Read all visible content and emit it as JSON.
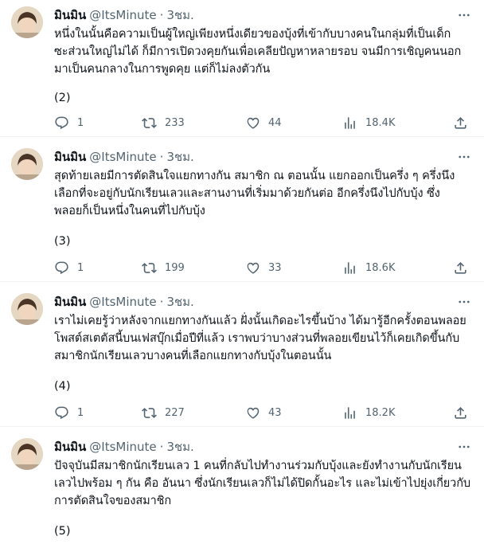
{
  "tweets": [
    {
      "name": "มินมิน",
      "handle": "@ItsMinute",
      "dot": "·",
      "time": "3ชม.",
      "text": "หนึ่งในนั้นคือความเป็นผู้ใหญ่เพียงหนึ่งเดียวของบุ้งที่เข้ากับบางคนในกลุ่มที่เป็นเด็ก\nซะส่วนใหญ่ไม่ได้ ก็มีการเปิดวงคุยกันเพื่อเคลียปัญหาหลายรอบ จนมีการเชิญคนนอก\nมาเป็นคนกลางในการพูดคุย แต่ก็ไม่ลงตัวกัน",
      "index": "(2)",
      "replies": "1",
      "retweets": "233",
      "likes": "44",
      "views": "18.4K"
    },
    {
      "name": "มินมิน",
      "handle": "@ItsMinute",
      "dot": "·",
      "time": "3ชม.",
      "text": "สุดท้ายเลยมีการตัดสินใจแยกทางกัน สมาชิก ณ ตอนนั้น แยกออกเป็นครึ่ง ๆ ครึ่งนึง\nเลือกที่จะอยู่กับนักเรียนเลวและสานงานที่เริ่มมาด้วยกันต่อ อีกครึ่งนึงไปกับบุ้ง ซึ่ง\nพลอยก็เป็นหนึ่งในคนที่ไปกับบุ้ง",
      "index": "(3)",
      "replies": "1",
      "retweets": "199",
      "likes": "33",
      "views": "18.6K"
    },
    {
      "name": "มินมิน",
      "handle": "@ItsMinute",
      "dot": "·",
      "time": "3ชม.",
      "text": "เราไม่เคยรู้ว่าหลังจากแยกทางกันแล้ว ฝั่งนั้นเกิดอะไรขึ้นบ้าง ได้มารู้อีกครั้งตอนพลอย\nโพสต์สเตตัสนี้บนเฟสบุ๊กเมื่อปีที่แล้ว เราพบว่าบางส่วนที่พลอยเขียนไว้ก็เคยเกิดขึ้นกับ\nสมาชิกนักเรียนเลวบางคนที่เลือกแยกทางกับบุ้งในตอนนั้น",
      "index": "(4)",
      "replies": "1",
      "retweets": "227",
      "likes": "43",
      "views": "18.2K"
    },
    {
      "name": "มินมิน",
      "handle": "@ItsMinute",
      "dot": "·",
      "time": "3ชม.",
      "text": "ปัจจุบันมีสมาชิกนักเรียนเลว 1 คนที่กลับไปทำงานร่วมกับบุ้งและยังทำงานกับนักเรียน\nเลวไปพร้อม ๆ กัน คือ อันนา ซึ่งนักเรียนเลวก็ไม่ได้ปิดกั้นอะไร และไม่เข้าไปยุ่งเกี่ยวกับ\nการตัดสินใจของสมาชิก",
      "index": "(5)"
    }
  ],
  "colors": {
    "text": "#0f1419",
    "secondary": "#536471",
    "divider": "#eff3f4"
  },
  "icons": [
    "more-icon",
    "reply-icon",
    "retweet-icon",
    "like-icon",
    "views-icon",
    "share-icon"
  ]
}
